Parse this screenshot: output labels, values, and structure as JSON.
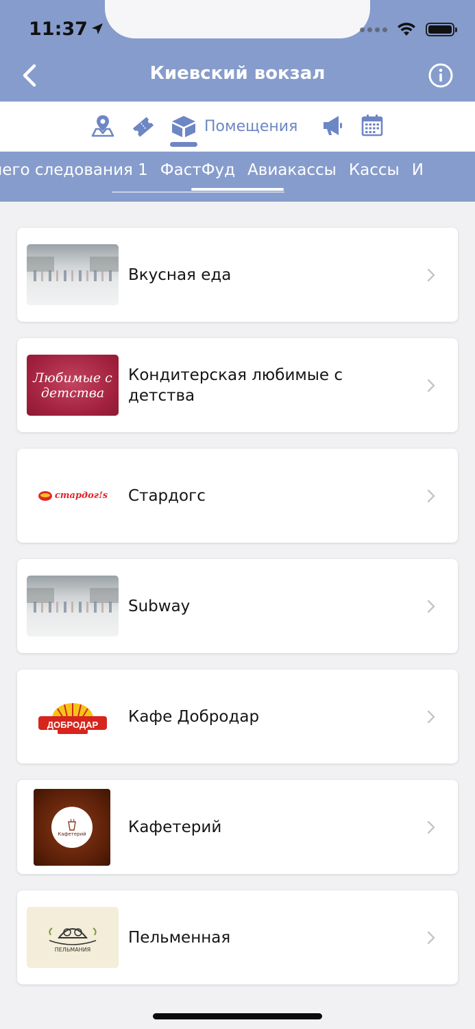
{
  "status_bar": {
    "time": "11:37"
  },
  "header": {
    "title": "Киевский вокзал"
  },
  "icon_tabs": {
    "active_label": "Помещения"
  },
  "categories": {
    "items": [
      "льнего следования 1",
      "ФастФуд",
      "Авиакассы",
      "Кассы",
      "И"
    ],
    "active_index": 1
  },
  "places": [
    {
      "name": "Вкусная еда",
      "thumb": "mall-photo"
    },
    {
      "name": "Кондитерская любимые с детства",
      "thumb": "candy-logo",
      "logo_text": "Любимые с детства"
    },
    {
      "name": "Стардогс",
      "thumb": "stardogs-logo",
      "logo_text": "стардог!s"
    },
    {
      "name": "Subway",
      "thumb": "mall-photo"
    },
    {
      "name": "Кафе Добродар",
      "thumb": "dobrodar-logo",
      "logo_text": "ДОБРОДАР"
    },
    {
      "name": "Кафетерий",
      "thumb": "cafeteria-logo",
      "logo_text": "Кафетерий"
    },
    {
      "name": "Пельменная",
      "thumb": "pelmeni-logo",
      "logo_text": "ПЕЛЬМАНИЯ"
    }
  ],
  "colors": {
    "header": "#869ccc",
    "accent": "#6d86c4",
    "background": "#f1f1f3"
  }
}
